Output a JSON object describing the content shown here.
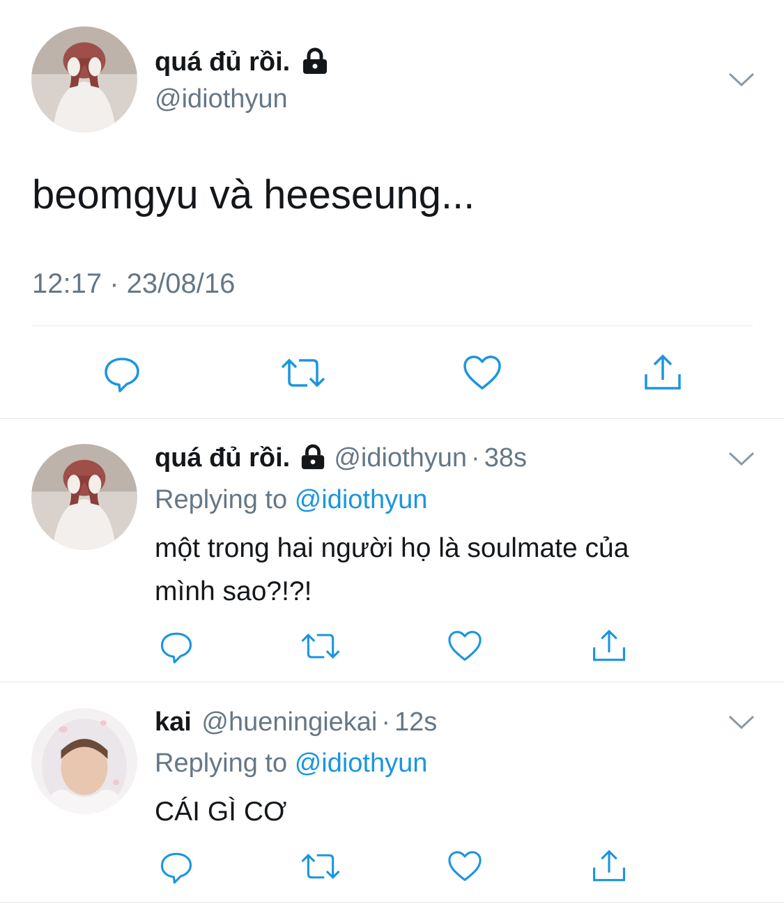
{
  "main_tweet": {
    "display_name": "quá đủ rồi.",
    "handle": "@idiothyun",
    "text": "beomgyu và heeseung...",
    "timestamp": "12:17 · 23/08/16",
    "avatar_icon": "user-avatar"
  },
  "replies": [
    {
      "display_name": "quá đủ rồi.",
      "handle": "@idiothyun",
      "time": "38s",
      "replying_prefix": "Replying to",
      "replying_handle": "@idiothyun",
      "text_line1": "một trong hai người họ là soulmate của",
      "text_line2": "mình sao?!?!",
      "locked": true
    },
    {
      "display_name": "kai",
      "handle": "@hueningiekai",
      "time": "12s",
      "replying_prefix": "Replying to",
      "replying_handle": "@idiothyun",
      "text_line1": "CÁI GÌ CƠ",
      "locked": false
    }
  ],
  "separator": "·",
  "colors": {
    "text": "#14171a",
    "muted": "#657786",
    "link": "#1b95e0",
    "divider": "#e1e8ed",
    "icon": "#1b95e0"
  },
  "icons": [
    "lock-icon",
    "chevron-down-icon",
    "reply-icon",
    "retweet-icon",
    "like-icon",
    "share-icon"
  ]
}
